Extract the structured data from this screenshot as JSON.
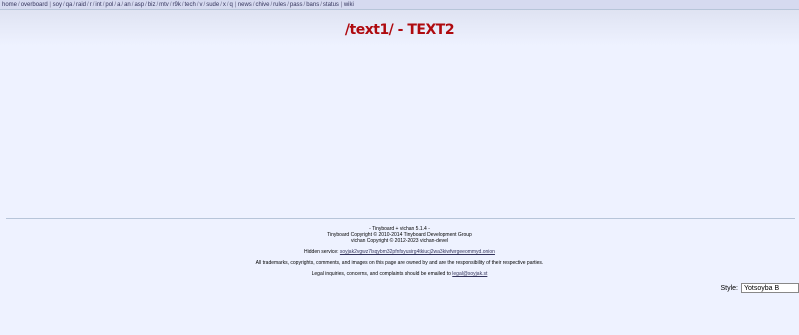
{
  "boardlist": {
    "groups": [
      [
        "home",
        "overboard"
      ],
      [
        "soy",
        "qa",
        "raid",
        "r",
        "int",
        "pol",
        "a",
        "an",
        "asp",
        "biz",
        "mtv",
        "r9k",
        "tech",
        "v",
        "sude",
        "x",
        "q"
      ],
      [
        "news",
        "chive",
        "rules",
        "pass",
        "bans",
        "status"
      ],
      [
        "wiki"
      ]
    ]
  },
  "header": {
    "title": "/text1/ - TEXT2"
  },
  "footer": {
    "line1": "- Tinyboard + vichan 5.1.4 -",
    "line2": "Tinyboard Copyright © 2010-2014 Tinyboard Development Group",
    "line3": "vichan Copyright © 2012-2023 vichan-devel",
    "hidden_prefix": "Hidden service: ",
    "hidden_link": "soyjak2vgwz7lsqybm32pfnfsyusirg4tkiucj2wa3kiwfwrgeeommyd.onion",
    "trademarks": "All trademarks, copyrights, comments, and images on this page are owned by and are the responsibility of their respective parties.",
    "legal_prefix": "Legal inquiries, concerns, and complaints should be emailed to ",
    "legal_email": "legal@soyjak.st"
  },
  "style_selector": {
    "label": "Style:",
    "value": "Yotsoyba B"
  }
}
